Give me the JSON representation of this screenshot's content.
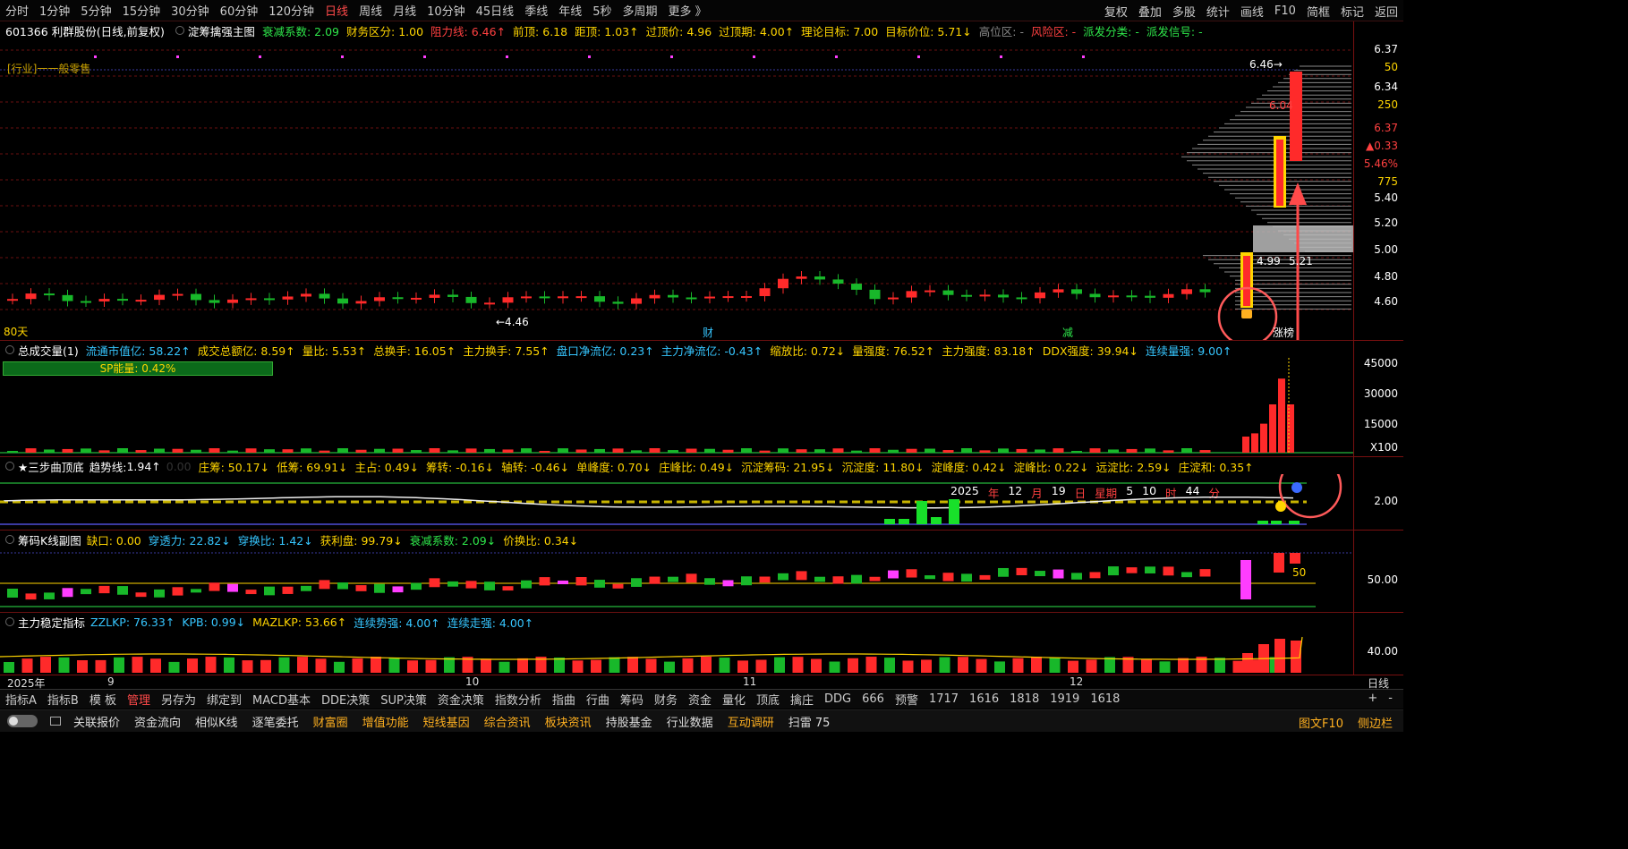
{
  "toolbar": {
    "periods": [
      "分时",
      "1分钟",
      "5分钟",
      "15分钟",
      "30分钟",
      "60分钟",
      "120分钟",
      "日线",
      "周线",
      "月线",
      "10分钟",
      "45日线",
      "季线",
      "年线",
      "5秒",
      "多周期",
      "更多 》"
    ],
    "active_period": "日线",
    "right": [
      "复权",
      "叠加",
      "多股",
      "统计",
      "画线",
      "F10",
      "简框",
      "标记",
      "返回"
    ]
  },
  "main": {
    "stock": "601366 利群股份(日线,前复权)",
    "indicator": "淀筹擒强主图",
    "metrics": [
      {
        "label": "衰减系数:",
        "value": "2.09",
        "cls": "g"
      },
      {
        "label": "财务区分:",
        "value": "1.00",
        "cls": "y"
      },
      {
        "label": "阻力线:",
        "value": "6.46↑",
        "cls": "r"
      },
      {
        "label": "前顶:",
        "value": "6.18",
        "cls": "y"
      },
      {
        "label": "距顶:",
        "value": "1.03↑",
        "cls": "y"
      },
      {
        "label": "过顶价:",
        "value": "4.96",
        "cls": "y"
      },
      {
        "label": "过顶期:",
        "value": "4.00↑",
        "cls": "y"
      },
      {
        "label": "理论目标:",
        "value": "7.00",
        "cls": "y"
      },
      {
        "label": "目标价位:",
        "value": "5.71↓",
        "cls": "y"
      },
      {
        "label": "高位区:",
        "value": "-",
        "cls": "gr"
      },
      {
        "label": "风险区:",
        "value": "-",
        "cls": "r"
      },
      {
        "label": "派发分类:",
        "value": "-",
        "cls": "g"
      },
      {
        "label": "派发信号:",
        "value": "-",
        "cls": "g"
      }
    ],
    "industry": "[行业]一一般零售",
    "days": "80天",
    "low_label": "←4.46",
    "high_label": "6.46→",
    "mid_label": "6.04",
    "box_left": "4.99",
    "box_right": "5.21",
    "badge_cai": "财",
    "badge_jian": "减",
    "zhangbang": "涨榜"
  },
  "main_axis": [
    {
      "t": "6.37",
      "cls": "w"
    },
    {
      "t": "50",
      "cls": "y"
    },
    {
      "t": "6.34",
      "cls": "w"
    },
    {
      "t": "250",
      "cls": "y"
    },
    {
      "t": "6.37",
      "cls": "r"
    },
    {
      "t": "▲0.33",
      "cls": "r"
    },
    {
      "t": "5.46%",
      "cls": "r"
    },
    {
      "t": "775",
      "cls": "y"
    },
    {
      "t": "5.40",
      "cls": "w"
    },
    {
      "t": "5.20",
      "cls": "w"
    },
    {
      "t": "5.00",
      "cls": "w"
    },
    {
      "t": "4.80",
      "cls": "w"
    },
    {
      "t": "4.60",
      "cls": "w"
    }
  ],
  "vol": {
    "title": "总成交量(1)",
    "metrics": [
      {
        "label": "流通市值亿:",
        "value": "58.22↑",
        "cls": "c"
      },
      {
        "label": "成交总额亿:",
        "value": "8.59↑",
        "cls": "y"
      },
      {
        "label": "量比:",
        "value": "5.53↑",
        "cls": "y"
      },
      {
        "label": "总换手:",
        "value": "16.05↑",
        "cls": "y"
      },
      {
        "label": "主力换手:",
        "value": "7.55↑",
        "cls": "y"
      },
      {
        "label": "盘口净流亿:",
        "value": "0.23↑",
        "cls": "c"
      },
      {
        "label": "主力净流亿:",
        "value": "-0.43↑",
        "cls": "c"
      },
      {
        "label": "缩放比:",
        "value": "0.72↓",
        "cls": "y"
      },
      {
        "label": "量强度:",
        "value": "76.52↑",
        "cls": "y"
      },
      {
        "label": "主力强度:",
        "value": "83.18↑",
        "cls": "y"
      },
      {
        "label": "DDX强度:",
        "value": "39.94↓",
        "cls": "y"
      },
      {
        "label": "连续量强:",
        "value": "9.00↑",
        "cls": "c"
      }
    ],
    "sp_label": "SP能量:",
    "sp_value": "0.42%",
    "axis": [
      "45000",
      "30000",
      "15000",
      "X100"
    ]
  },
  "step": {
    "title": "★三步曲顶底",
    "trend_label": "趋势线:",
    "trend_value": "1.94↑",
    "dim": "0.00",
    "metrics": [
      {
        "label": "庄筹:",
        "value": "50.17↓",
        "cls": "y"
      },
      {
        "label": "低筹:",
        "value": "69.91↓",
        "cls": "y"
      },
      {
        "label": "主占:",
        "value": "0.49↓",
        "cls": "y"
      },
      {
        "label": "筹转:",
        "value": "-0.16↓",
        "cls": "y"
      },
      {
        "label": "轴转:",
        "value": "-0.46↓",
        "cls": "y"
      },
      {
        "label": "单峰度:",
        "value": "0.70↓",
        "cls": "y"
      },
      {
        "label": "庄峰比:",
        "value": "0.49↓",
        "cls": "y"
      },
      {
        "label": "沉淀筹码:",
        "value": "21.95↓",
        "cls": "y"
      },
      {
        "label": "沉淀度:",
        "value": "11.80↓",
        "cls": "y"
      },
      {
        "label": "淀峰度:",
        "value": "0.42↓",
        "cls": "y"
      },
      {
        "label": "淀峰比:",
        "value": "0.22↓",
        "cls": "y"
      },
      {
        "label": "远淀比:",
        "value": "2.59↓",
        "cls": "y"
      },
      {
        "label": "庄淀和:",
        "value": "0.35↑",
        "cls": "y"
      }
    ],
    "date": [
      {
        "t": "2025",
        "cls": "w"
      },
      {
        "t": "年",
        "cls": "r"
      },
      {
        "t": "12",
        "cls": "w"
      },
      {
        "t": "月",
        "cls": "r"
      },
      {
        "t": "19",
        "cls": "w"
      },
      {
        "t": "日",
        "cls": "r"
      },
      {
        "t": "星期",
        "cls": "r"
      },
      {
        "t": "5",
        "cls": "w"
      },
      {
        "t": "10",
        "cls": "w"
      },
      {
        "t": "时",
        "cls": "r"
      },
      {
        "t": "44",
        "cls": "w"
      },
      {
        "t": "分",
        "cls": "r"
      }
    ],
    "axis": "2.00"
  },
  "chip": {
    "title": "筹码K线副图",
    "metrics": [
      {
        "label": "缺口:",
        "value": "0.00",
        "cls": "y"
      },
      {
        "label": "穿透力:",
        "value": "22.82↓",
        "cls": "c"
      },
      {
        "label": "穿换比:",
        "value": "1.42↓",
        "cls": "c"
      },
      {
        "label": "获利盘:",
        "value": "99.79↓",
        "cls": "y"
      },
      {
        "label": "衰减系数:",
        "value": "2.09↓",
        "cls": "g"
      },
      {
        "label": "价换比:",
        "value": "0.34↓",
        "cls": "y"
      }
    ],
    "label50": "50",
    "axis": "50.00"
  },
  "main_force": {
    "title": "主力稳定指标",
    "metrics": [
      {
        "label": "ZZLKP:",
        "value": "76.33↑",
        "cls": "c"
      },
      {
        "label": "KPB:",
        "value": "0.99↓",
        "cls": "c"
      },
      {
        "label": "MAZLKP:",
        "value": "53.66↑",
        "cls": "y"
      },
      {
        "label": "连续势强:",
        "value": "4.00↑",
        "cls": "c"
      },
      {
        "label": "连续走强:",
        "value": "4.00↑",
        "cls": "c"
      }
    ],
    "axis": "40.00"
  },
  "time_axis": {
    "labels": [
      "2025年",
      "9",
      "10",
      "11",
      "12"
    ],
    "right": "日线"
  },
  "bottom1": {
    "items": [
      "指标A",
      "指标B",
      "模 板",
      "管理",
      "另存为",
      "绑定到",
      "MACD基本",
      "DDE决策",
      "SUP决策",
      "资金决策",
      "指数分析",
      "指曲",
      "行曲",
      "筹码",
      "财务",
      "资金",
      "量化",
      "顶底",
      "擒庄",
      "DDG",
      "666",
      "预警",
      "1717",
      "1616",
      "1818",
      "1919",
      "1618"
    ],
    "active": "管理",
    "right": [
      "+",
      "-"
    ]
  },
  "bottom2": {
    "items": [
      {
        "t": "关联报价",
        "o": false
      },
      {
        "t": "资金流向",
        "o": false
      },
      {
        "t": "相似K线",
        "o": false
      },
      {
        "t": "逐笔委托",
        "o": false
      },
      {
        "t": "财富圈",
        "o": true
      },
      {
        "t": "增值功能",
        "o": true
      },
      {
        "t": "短线基因",
        "o": true
      },
      {
        "t": "综合资讯",
        "o": true
      },
      {
        "t": "板块资讯",
        "o": true
      },
      {
        "t": "持股基金",
        "o": false
      },
      {
        "t": "行业数据",
        "o": false
      },
      {
        "t": "互动调研",
        "o": true
      },
      {
        "t": "扫雷 75",
        "o": false
      }
    ],
    "right": [
      "图文F10",
      "侧边栏"
    ]
  },
  "colors": {
    "up": "#ff2a2a",
    "down": "#18b82a",
    "yellow": "#ffd500",
    "cyan": "#36c6ff",
    "magenta": "#ff3dff",
    "frame": "#7a1010"
  }
}
